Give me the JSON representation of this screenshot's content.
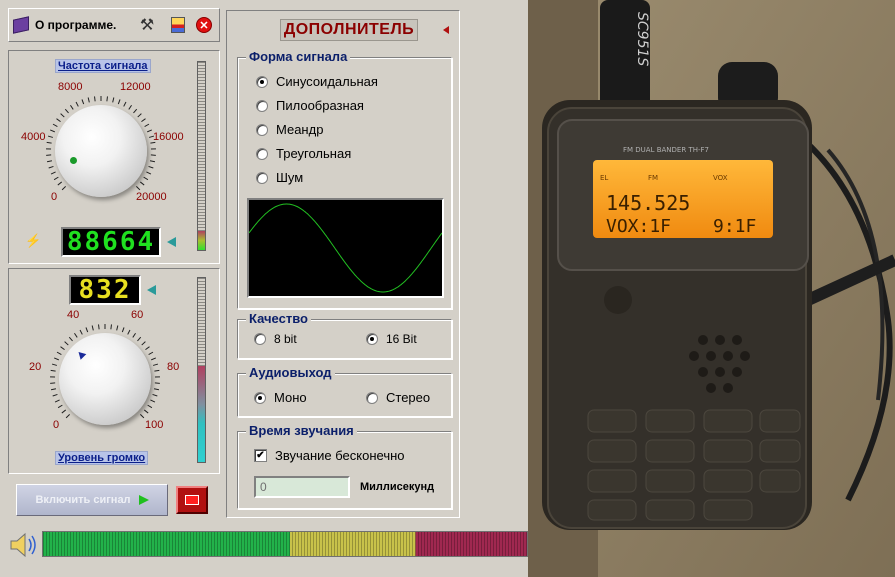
{
  "toolbar": {
    "about_label": "О программе."
  },
  "frequency": {
    "label": "Частота сигнала",
    "scale": [
      "0",
      "4000",
      "8000",
      "12000",
      "16000",
      "20000"
    ],
    "display": "88664",
    "knob_value_hz": 2200,
    "level": 0.1
  },
  "volume": {
    "display": "832",
    "label": "Уровень громко",
    "scale": [
      "0",
      "20",
      "40",
      "60",
      "80",
      "100"
    ],
    "knob_value": 32,
    "level": 0.52
  },
  "start_button": {
    "label": "Включить сигнал"
  },
  "settings": {
    "title": "ДОПОЛНИТЕЛЬ",
    "waveform": {
      "label": "Форма сигнала",
      "options": [
        "Синусоидальная",
        "Пилообразная",
        "Меандр",
        "Треугольная",
        "Шум"
      ],
      "selected": "Синусоидальная"
    },
    "quality": {
      "label": "Качество",
      "options": [
        "8 bit",
        "16 Bit"
      ],
      "selected": "16 Bit"
    },
    "audio_out": {
      "label": "Аудиовыход",
      "options": [
        "Моно",
        "Стерео"
      ],
      "selected": "Моно"
    },
    "duration": {
      "label": "Время звучания",
      "infinite_label": "Звучание бесконечно",
      "infinite_checked": true,
      "ms_value": "0",
      "ms_label": "Миллисекунд"
    }
  },
  "spectrum": {
    "green_share": 0.51,
    "yellow_share": 0.26,
    "red_share": 0.23
  },
  "photo": {
    "antenna_text": "SC951S",
    "radio_model": "FM DUAL BANDER TH-F7",
    "screen_indicators": [
      "EL",
      "FM",
      "VOX"
    ],
    "frequency": "145.525",
    "line2_left": "VOX:1F",
    "line2_right": "9:1F"
  },
  "colors": {
    "window_bg": "#d4d0c8",
    "group_title": "#0b1f6a",
    "scale_text": "#8b0000",
    "lcd_green": "#20e020",
    "lcd_yellow": "#e8e020",
    "radio_screen": "#f5a020"
  }
}
